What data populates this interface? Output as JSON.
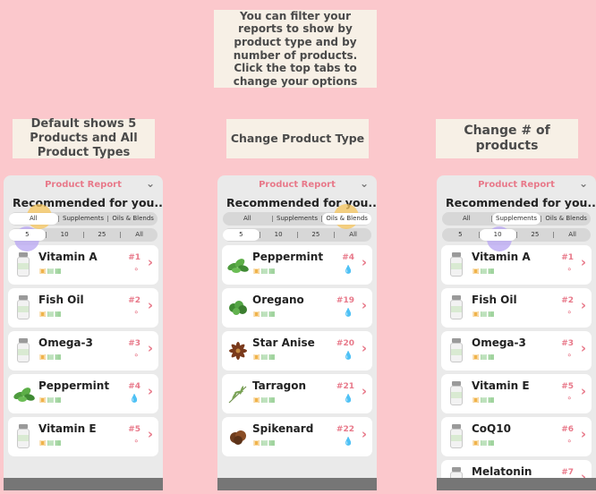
{
  "notes": {
    "top": "You can filter your reports to show by product type and by number of products. Click the top tabs to change your options",
    "left": "Default shows 5 Products and All Product Types",
    "middle": "Change Product Type",
    "right": "Change # of products"
  },
  "phones": [
    {
      "header": "Product Report",
      "title": "Recommended for you...",
      "type_tabs": [
        "All",
        "Supplements",
        "Oils & Blends"
      ],
      "type_selected": 0,
      "count_tabs": [
        "5",
        "10",
        "25",
        "All"
      ],
      "count_selected": 0,
      "highlight": {
        "orange": "type",
        "purple": "count"
      },
      "items": [
        {
          "name": "Vitamin A",
          "rank": "#1",
          "kind": "bottle",
          "rank_icon": "pill-icon"
        },
        {
          "name": "Fish Oil",
          "rank": "#2",
          "kind": "bottle",
          "rank_icon": "pill-icon"
        },
        {
          "name": "Omega-3",
          "rank": "#3",
          "kind": "bottle",
          "rank_icon": "pill-icon"
        },
        {
          "name": "Peppermint",
          "rank": "#4",
          "kind": "mint",
          "rank_icon": "drop-icon"
        },
        {
          "name": "Vitamin E",
          "rank": "#5",
          "kind": "bottle",
          "rank_icon": "pill-icon"
        }
      ]
    },
    {
      "header": "Product Report",
      "title": "Recommended for you...",
      "type_tabs": [
        "All",
        "Supplements",
        "Oils & Blends"
      ],
      "type_selected": 2,
      "count_tabs": [
        "5",
        "10",
        "25",
        "All"
      ],
      "count_selected": 0,
      "highlight": {
        "orange": "type"
      },
      "items": [
        {
          "name": "Peppermint",
          "rank": "#4",
          "kind": "mint",
          "rank_icon": "drop-icon"
        },
        {
          "name": "Oregano",
          "rank": "#19",
          "kind": "oregano",
          "rank_icon": "drop-icon"
        },
        {
          "name": "Star Anise",
          "rank": "#20",
          "kind": "anise",
          "rank_icon": "drop-icon"
        },
        {
          "name": "Tarragon",
          "rank": "#21",
          "kind": "tarragon",
          "rank_icon": "drop-icon"
        },
        {
          "name": "Spikenard",
          "rank": "#22",
          "kind": "spikenard",
          "rank_icon": "drop-icon"
        }
      ]
    },
    {
      "header": "Product Report",
      "title": "Recommended for you...",
      "type_tabs": [
        "All",
        "Supplements",
        "Oils & Blends"
      ],
      "type_selected": 1,
      "count_tabs": [
        "5",
        "10",
        "25",
        "All"
      ],
      "count_selected": 1,
      "highlight": {
        "purple": "count"
      },
      "items": [
        {
          "name": "Vitamin A",
          "rank": "#1",
          "kind": "bottle",
          "rank_icon": "pill-icon"
        },
        {
          "name": "Fish Oil",
          "rank": "#2",
          "kind": "bottle",
          "rank_icon": "pill-icon"
        },
        {
          "name": "Omega-3",
          "rank": "#3",
          "kind": "bottle",
          "rank_icon": "pill-icon"
        },
        {
          "name": "Vitamin E",
          "rank": "#5",
          "kind": "bottle",
          "rank_icon": "pill-icon"
        },
        {
          "name": "CoQ10",
          "rank": "#6",
          "kind": "bottle",
          "rank_icon": "pill-icon"
        },
        {
          "name": "Melatonin",
          "rank": "#7",
          "kind": "bottle",
          "rank_icon": "pill-icon"
        }
      ]
    }
  ],
  "icons": {
    "chevron": "chevron-down-icon",
    "go": "chevron-right-icon",
    "tags": [
      "leaf-icon",
      "capsule-icon",
      "tablet-icon"
    ]
  },
  "colors": {
    "background": "#fbc8cc",
    "note_bg": "#f7f0e6",
    "accent": "#e8798a",
    "highlight_orange": "#f7c65c",
    "highlight_purple": "#b7a4f1"
  }
}
